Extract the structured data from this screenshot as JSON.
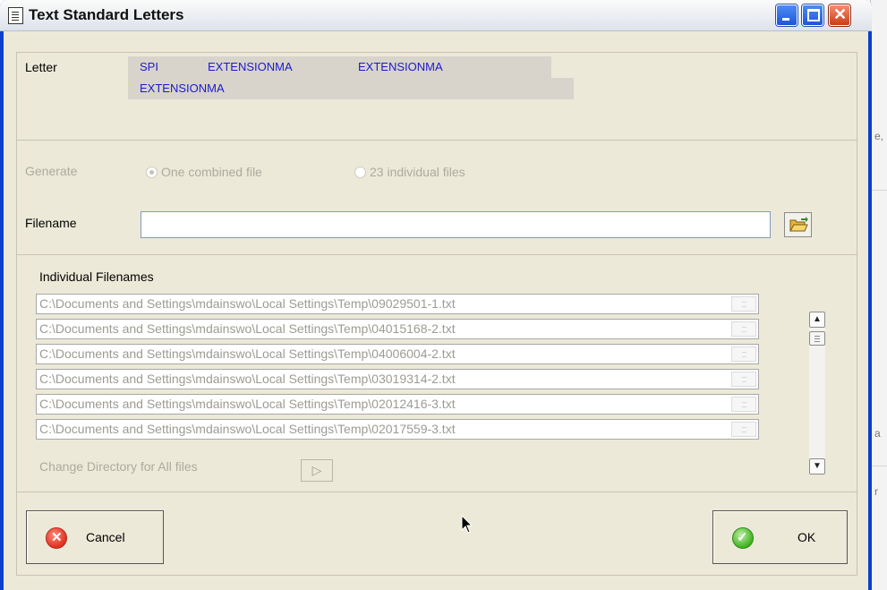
{
  "window": {
    "title": "Text Standard Letters"
  },
  "letter": {
    "label": "Letter",
    "chips": [
      "SPI",
      "EXTENSIONMA",
      "EXTENSIONMA",
      "EXTENSIONMA"
    ]
  },
  "generate": {
    "label": "Generate",
    "option_combined": "One combined file",
    "option_individual": "23 individual files",
    "selected": "One combined file"
  },
  "filename": {
    "label": "Filename",
    "value": ""
  },
  "individual": {
    "heading": "Individual Filenames",
    "files": [
      "C:\\Documents and Settings\\mdainswo\\Local Settings\\Temp\\09029501-1.txt",
      "C:\\Documents and Settings\\mdainswo\\Local Settings\\Temp\\04015168-2.txt",
      "C:\\Documents and Settings\\mdainswo\\Local Settings\\Temp\\04006004-2.txt",
      "C:\\Documents and Settings\\mdainswo\\Local Settings\\Temp\\03019314-2.txt",
      "C:\\Documents and Settings\\mdainswo\\Local Settings\\Temp\\02012416-3.txt",
      "C:\\Documents and Settings\\mdainswo\\Local Settings\\Temp\\02017559-3.txt"
    ],
    "change_dir_label": "Change Directory for All files",
    "change_dir_arrow": "▷"
  },
  "buttons": {
    "cancel": "Cancel",
    "ok": "OK"
  },
  "background_window": {
    "fragments": [
      "e,",
      "a",
      "r"
    ]
  },
  "colors": {
    "title_bar": "#eef0f4",
    "dialog_bg": "#ece9d8",
    "chip_text": "#1a1ad0",
    "disabled_text": "#acaa9f",
    "close_button": "#cc3d18"
  }
}
